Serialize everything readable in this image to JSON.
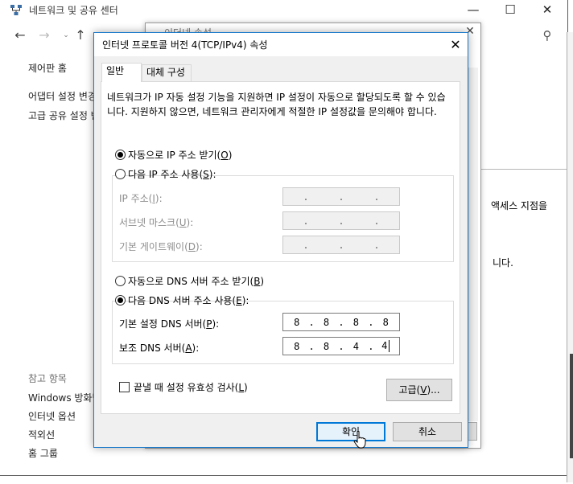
{
  "background_window": {
    "title": "네트워크 및 공유 센터",
    "caption_buttons": {
      "minimize": "—",
      "maximize": "☐",
      "close": "✕"
    },
    "nav": {
      "back": "←",
      "forward": "→",
      "recent": "⌄",
      "up": "↑",
      "search_icon": "⚲"
    },
    "sidebar": {
      "home": "제어판 홈",
      "change_adapter": "어댑터 설정 변경",
      "advanced_sharing": "고급 공유 설정 변경",
      "see_also": "참고 항목",
      "firewall": "Windows 방화벽",
      "internet_options": "인터넷 옵션",
      "infrared": "적외선",
      "homegroup": "홈 그룹"
    },
    "main_fragment_1": "액세스 지점을",
    "main_fragment_2": "니다."
  },
  "middle_window": {
    "title": "이더넷 속성",
    "close": "✕"
  },
  "dialog": {
    "title": "인터넷 프로토콜 버전 4(TCP/IPv4) 속성",
    "close": "✕",
    "tabs": {
      "general": "일반",
      "alternate": "대체 구성"
    },
    "description": "네트워크가 IP 자동 설정 기능을 지원하면 IP 설정이 자동으로 할당되도록 할 수 있습니다. 지원하지 않으면, 네트워크 관리자에게 적절한 IP 설정값을 문의해야 합니다.",
    "ip_mode": {
      "auto_label": "자동으로 IP 주소 받기",
      "auto_key": "O",
      "manual_label": "다음 IP 주소 사용",
      "manual_key": "S",
      "selected": "auto"
    },
    "ip_fields": {
      "ip_label": "IP 주소",
      "ip_key": "I",
      "mask_label": "서브넷 마스크",
      "mask_key": "U",
      "gateway_label": "기본 게이트웨이",
      "gateway_key": "D",
      "dots": "."
    },
    "dns_mode": {
      "auto_label": "자동으로 DNS 서버 주소 받기",
      "auto_key": "B",
      "manual_label": "다음 DNS 서버 주소 사용",
      "manual_key": "E",
      "selected": "manual"
    },
    "dns_fields": {
      "preferred_label": "기본 설정 DNS 서버",
      "preferred_key": "P",
      "preferred_octets": [
        "8",
        "8",
        "8",
        "8"
      ],
      "alternate_label": "보조 DNS 서버",
      "alternate_key": "A",
      "alternate_octets": [
        "8",
        "8",
        "4",
        "4"
      ]
    },
    "validate_on_exit": {
      "label": "끝낼 때 설정 유효성 검사",
      "key": "L",
      "checked": false
    },
    "advanced_button": "고급",
    "advanced_key": "V",
    "ok_button": "확인",
    "cancel_button": "취소"
  },
  "colors": {
    "accent": "#0078d7",
    "dialog_border": "#1979ca",
    "disabled_text": "#8d8d8d"
  }
}
